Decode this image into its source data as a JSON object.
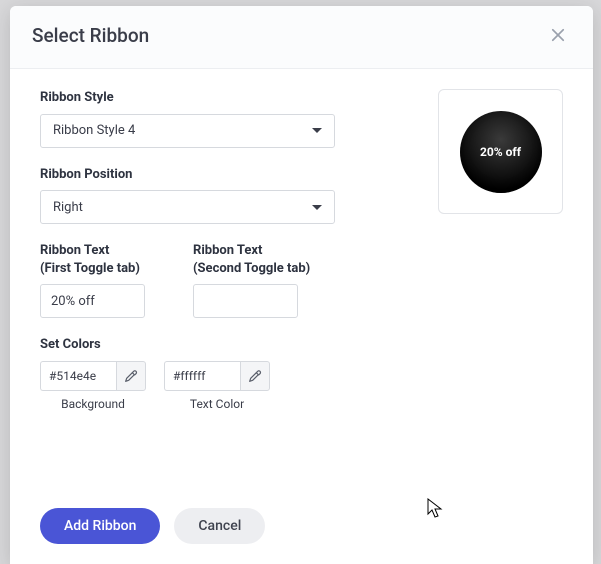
{
  "modal": {
    "title": "Select Ribbon"
  },
  "fields": {
    "style": {
      "label": "Ribbon Style",
      "value": "Ribbon Style 4"
    },
    "position": {
      "label": "Ribbon Position",
      "value": "Right"
    },
    "text1": {
      "label": "Ribbon Text\n(First Toggle tab)",
      "value": "20% off"
    },
    "text2": {
      "label": "Ribbon Text\n(Second Toggle tab)",
      "value": ""
    }
  },
  "colors": {
    "heading": "Set Colors",
    "background": {
      "value": "#514e4e",
      "label": "Background"
    },
    "text": {
      "value": "#ffffff",
      "label": "Text Color"
    }
  },
  "preview": {
    "text": "20% off"
  },
  "footer": {
    "primary": "Add Ribbon",
    "secondary": "Cancel"
  }
}
